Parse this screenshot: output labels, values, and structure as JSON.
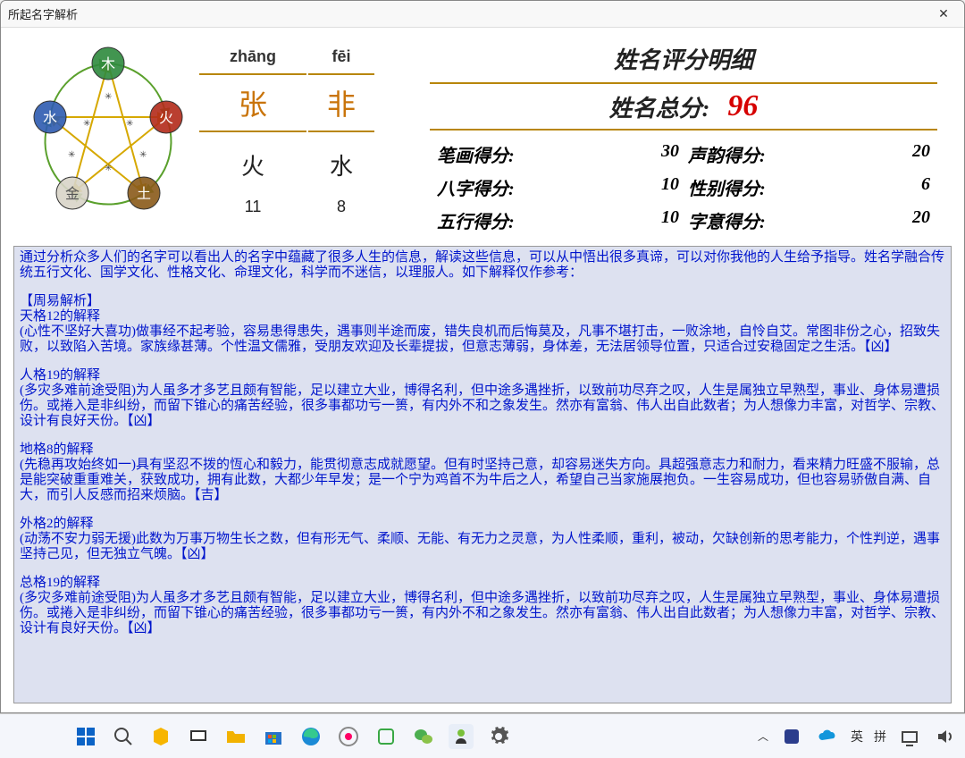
{
  "window": {
    "title": "所起名字解析"
  },
  "name": {
    "pinyin": [
      "zhāng",
      "fēi"
    ],
    "chars": [
      "张",
      "非"
    ],
    "elements": [
      "火",
      "水"
    ],
    "strokes": [
      "11",
      "8"
    ]
  },
  "score": {
    "title": "姓名评分明细",
    "total_label": "姓名总分:",
    "total": "96",
    "subs": [
      {
        "label": "笔画得分:",
        "value": "30"
      },
      {
        "label": "声韵得分:",
        "value": "20"
      },
      {
        "label": "八字得分:",
        "value": "10"
      },
      {
        "label": "性别得分:",
        "value": "6"
      },
      {
        "label": "五行得分:",
        "value": "10"
      },
      {
        "label": "字意得分:",
        "value": "20"
      }
    ]
  },
  "analysis": {
    "intro": "通过分析众多人们的名字可以看出人的名字中蕴藏了很多人生的信息，解读这些信息，可以从中悟出很多真谛，可以对你我他的人生给予指导。姓名学融合传统五行文化、国学文化、性格文化、命理文化，科学而不迷信，以理服人。如下解释仅作参考：",
    "section_head": "【周易解析】",
    "tian_h": "天格12的解释",
    "tian_b": "(心性不坚好大喜功)做事经不起考验，容易患得患失，遇事则半途而废，错失良机而后悔莫及，凡事不堪打击，一败涂地，自怜自艾。常图非份之心，招致失败，以致陷入苦境。家族缘甚薄。个性温文儒雅，受朋友欢迎及长辈提拔，但意志薄弱，身体差，无法居领导位置，只适合过安稳固定之生活。【凶】",
    "ren_h": "人格19的解释",
    "ren_b": "(多灾多难前途受阻)为人虽多才多艺且颇有智能，足以建立大业，博得名利，但中途多遇挫折，以致前功尽弃之叹，人生是属独立早熟型，事业、身体易遭损伤。或捲入是非纠纷，而留下锥心的痛苦经验，很多事都功亏一篑，有内外不和之象发生。然亦有富翁、伟人出自此数者；为人想像力丰富，对哲学、宗教、设计有良好天份。【凶】",
    "di_h": "地格8的解释",
    "di_b": "(先稳再攻始终如一)具有坚忍不拨的恆心和毅力，能贯彻意志成就愿望。但有时坚持己意，却容易迷失方向。具超强意志力和耐力，看来精力旺盛不服输，总是能突破重重难关，获致成功，拥有此数，大都少年早发；是一个宁为鸡首不为牛后之人，希望自己当家施展抱负。一生容易成功，但也容易骄傲自满、自大，而引人反感而招来烦脑。【吉】",
    "wai_h": "外格2的解释",
    "wai_b": "(动荡不安力弱无援)此数为万事万物生长之数，但有形无气、柔顺、无能、有无力之灵意，为人性柔顺，重利，被动，欠缺创新的思考能力，个性判逆，遇事坚持己见，但无独立气魄。【凶】",
    "zong_h": "总格19的解释",
    "zong_b": "(多灾多难前途受阻)为人虽多才多艺且颇有智能，足以建立大业，博得名利，但中途多遇挫折，以致前功尽弃之叹，人生是属独立早熟型，事业、身体易遭损伤。或捲入是非纠纷，而留下锥心的痛苦经验，很多事都功亏一篑，有内外不和之象发生。然亦有富翁、伟人出自此数者；为人想像力丰富，对哲学、宗教、设计有良好天份。【凶】"
  },
  "tray": {
    "ime1": "英",
    "ime2": "拼"
  }
}
